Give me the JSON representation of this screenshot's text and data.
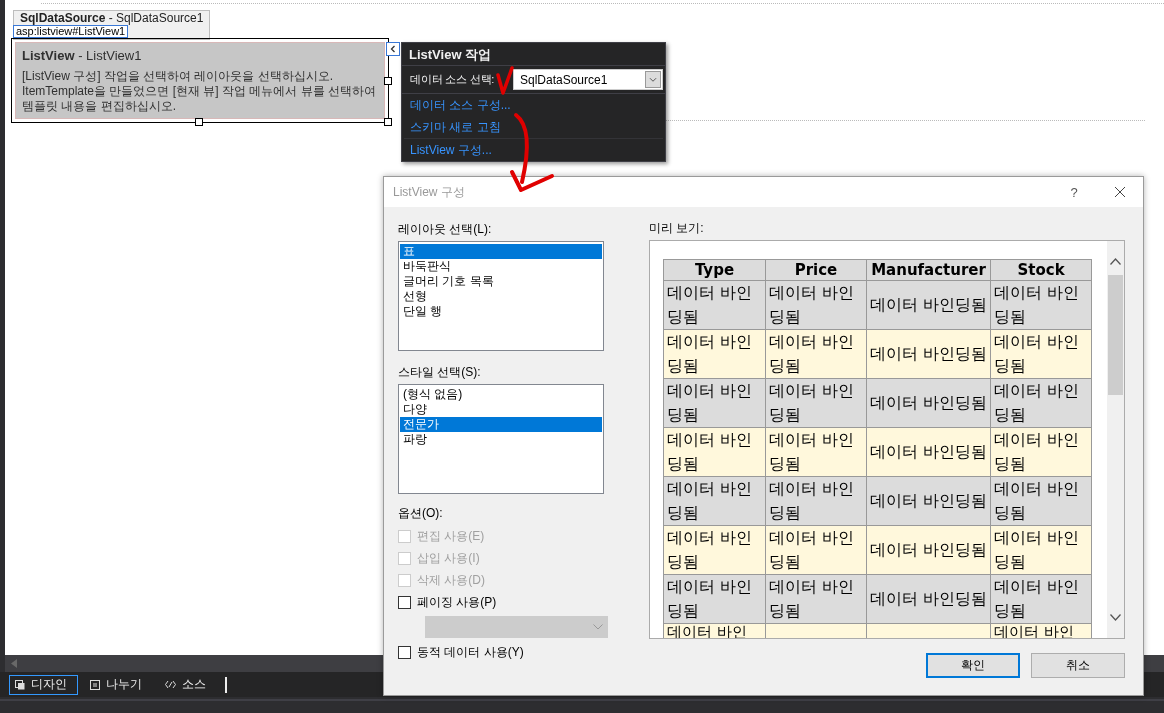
{
  "designer": {
    "data_source_box": "**SqlDataSource** - SqlDataSource1",
    "element_tag": "asp:listview#ListView1",
    "listview": {
      "title": "**ListView** - ListView1",
      "message": "[ListView 구성] 작업을 선택하여 레이아웃을 선택하십시오.\nItemTemplate을 만들었으면 [현재 뷰] 작업 메뉴에서 뷰를 선택하여\n템플릿 내용을 편집하십시오."
    }
  },
  "tasks_panel": {
    "title": "ListView 작업",
    "data_source_label": "데이터 소스 선택:",
    "data_source_value": "SqlDataSource1",
    "links": [
      "데이터 소스 구성...",
      "스키마 새로 고침",
      "ListView 구성..."
    ]
  },
  "dialog": {
    "title": "ListView 구성",
    "help": "?",
    "layout_label": "레이아웃 선택(L):",
    "layouts": [
      {
        "label": "표",
        "selected": true
      },
      {
        "label": "바둑판식",
        "selected": false
      },
      {
        "label": "글머리 기호 목록",
        "selected": false
      },
      {
        "label": "선형",
        "selected": false
      },
      {
        "label": "단일 행",
        "selected": false
      }
    ],
    "style_label": "스타일 선택(S):",
    "styles": [
      {
        "label": "(형식 없음)",
        "selected": false
      },
      {
        "label": "다양",
        "selected": false
      },
      {
        "label": "전문가",
        "selected": true
      },
      {
        "label": "파랑",
        "selected": false
      }
    ],
    "options_label": "옵션(O):",
    "options": [
      {
        "kind": "checkbox",
        "label": "편집 사용(E)",
        "checked": false,
        "disabled": true
      },
      {
        "kind": "checkbox",
        "label": "삽입 사용(I)",
        "checked": false,
        "disabled": true
      },
      {
        "kind": "checkbox",
        "label": "삭제 사용(D)",
        "checked": false,
        "disabled": true
      },
      {
        "kind": "checkbox",
        "label": "페이징 사용(P)",
        "checked": false,
        "disabled": false
      },
      {
        "kind": "dropdown",
        "disabled": true
      },
      {
        "kind": "checkbox",
        "label": "동적 데이터 사용(Y)",
        "checked": false,
        "disabled": false
      }
    ],
    "preview_label": "미리 보기:",
    "preview_table": {
      "columns": [
        "Type",
        "Price",
        "Manufacturer",
        "Stock"
      ],
      "rows": [
        [
          "데이터 바인딩됨",
          "데이터 바인딩됨",
          "데이터 바인딩됨",
          "데이터 바인딩됨"
        ],
        [
          "데이터 바인딩됨",
          "데이터 바인딩됨",
          "데이터 바인딩됨",
          "데이터 바인딩됨"
        ],
        [
          "데이터 바인딩됨",
          "데이터 바인딩됨",
          "데이터 바인딩됨",
          "데이터 바인딩됨"
        ],
        [
          "데이터 바인딩됨",
          "데이터 바인딩됨",
          "데이터 바인딩됨",
          "데이터 바인딩됨"
        ],
        [
          "데이터 바인딩됨",
          "데이터 바인딩됨",
          "데이터 바인딩됨",
          "데이터 바인딩됨"
        ],
        [
          "데이터 바인딩됨",
          "데이터 바인딩됨",
          "데이터 바인딩됨",
          "데이터 바인딩됨"
        ],
        [
          "데이터 바인딩됨",
          "데이터 바인딩됨",
          "데이터 바인딩됨",
          "데이터 바인딩됨"
        ],
        [
          "데이터 바인",
          null,
          null,
          "데이터 바인"
        ]
      ]
    },
    "buttons": [
      {
        "label": "확인",
        "default": true
      },
      {
        "label": "취소",
        "default": false
      }
    ]
  },
  "view_tabs": [
    {
      "label": "디자인",
      "selected": true
    },
    {
      "label": "나누기",
      "selected": false
    },
    {
      "label": "소스",
      "selected": false
    }
  ]
}
